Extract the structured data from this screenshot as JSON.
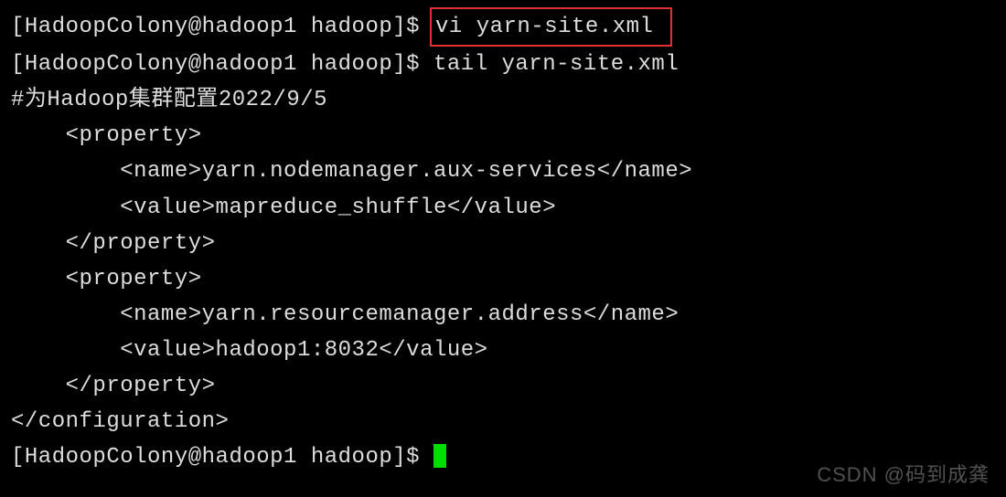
{
  "prompt1": {
    "prefix": "[HadoopColony@hadoop1 hadoop]$ ",
    "cmd": "vi yarn-site.xml "
  },
  "prompt2": {
    "prefix": "[HadoopColony@hadoop1 hadoop]$ ",
    "cmd": "tail yarn-site.xml"
  },
  "output": {
    "l1": "#为Hadoop集群配置2022/9/5",
    "l2": "    <property>",
    "l3": "        <name>yarn.nodemanager.aux-services</name>",
    "l4": "        <value>mapreduce_shuffle</value>",
    "l5": "    </property>",
    "l6": "    <property>",
    "l7": "        <name>yarn.resourcemanager.address</name>",
    "l8": "        <value>hadoop1:8032</value>",
    "l9": "    </property>",
    "l10": "</configuration>"
  },
  "prompt3": {
    "prefix": "[HadoopColony@hadoop1 hadoop]$ "
  },
  "watermark": "CSDN @码到成龚"
}
